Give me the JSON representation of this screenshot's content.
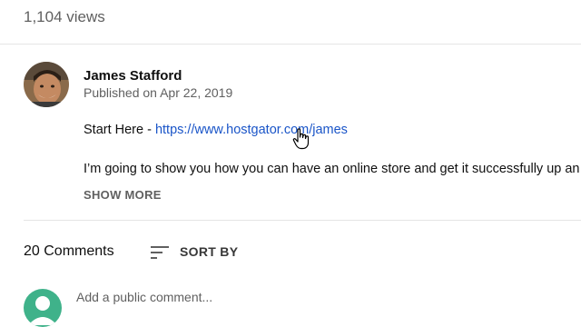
{
  "video": {
    "views": "1,104 views"
  },
  "channel": {
    "name": "James Stafford",
    "published": "Published on Apr 22, 2019"
  },
  "description": {
    "prefix": "Start Here - ",
    "link": "https://www.hostgator.com/james",
    "line2": "I’m going to show you how you can have an online store and get it successfully up an",
    "show_more": "SHOW MORE"
  },
  "comments": {
    "count": "20 Comments",
    "sort_label": "SORT BY",
    "placeholder": "Add a public comment..."
  },
  "colors": {
    "link": "#1a55c8",
    "user_avatar": "#3fb28a"
  },
  "icons": [
    "sort-icon",
    "hand-cursor-icon",
    "user-avatar-icon"
  ]
}
